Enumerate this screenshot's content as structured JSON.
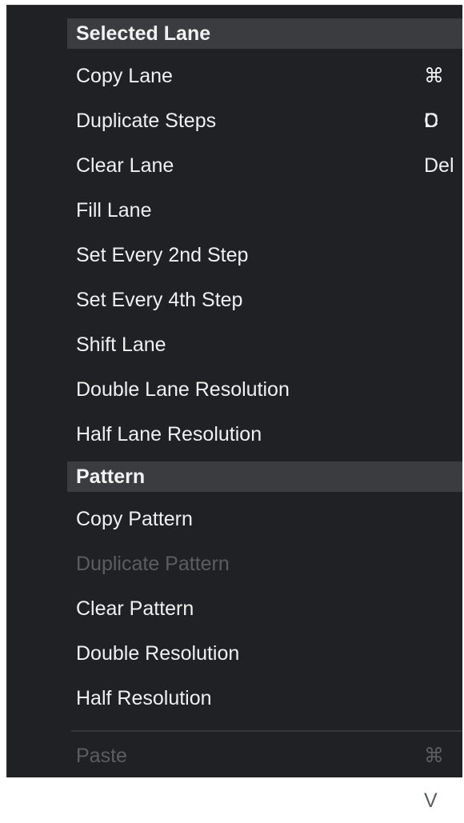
{
  "sections": [
    {
      "header": "Selected Lane",
      "items": [
        {
          "label": "Copy Lane",
          "shortcut": "⌘ C",
          "enabled": true
        },
        {
          "label": "Duplicate Steps",
          "shortcut": "D",
          "enabled": true
        },
        {
          "label": "Clear Lane",
          "shortcut": "Del",
          "enabled": true
        },
        {
          "label": "Fill Lane",
          "shortcut": "",
          "enabled": true
        },
        {
          "label": "Set Every 2nd Step",
          "shortcut": "",
          "enabled": true
        },
        {
          "label": "Set Every 4th Step",
          "shortcut": "",
          "enabled": true
        },
        {
          "label": "Shift Lane",
          "shortcut": "",
          "enabled": true
        },
        {
          "label": "Double Lane Resolution",
          "shortcut": "",
          "enabled": true
        },
        {
          "label": "Half Lane Resolution",
          "shortcut": "",
          "enabled": true
        }
      ]
    },
    {
      "header": "Pattern",
      "items": [
        {
          "label": "Copy Pattern",
          "shortcut": "",
          "enabled": true
        },
        {
          "label": "Duplicate Pattern",
          "shortcut": "",
          "enabled": false
        },
        {
          "label": "Clear Pattern",
          "shortcut": "",
          "enabled": true
        },
        {
          "label": "Double Resolution",
          "shortcut": "",
          "enabled": true
        },
        {
          "label": "Half Resolution",
          "shortcut": "",
          "enabled": true
        }
      ]
    }
  ],
  "footer_item": {
    "label": "Paste",
    "shortcut": "⌘ V",
    "enabled": false
  },
  "colors": {
    "menu_background": "#1f2124",
    "header_background": "#3a3c40",
    "text_enabled": "#f0f0f0",
    "text_disabled": "#5a5d62"
  }
}
